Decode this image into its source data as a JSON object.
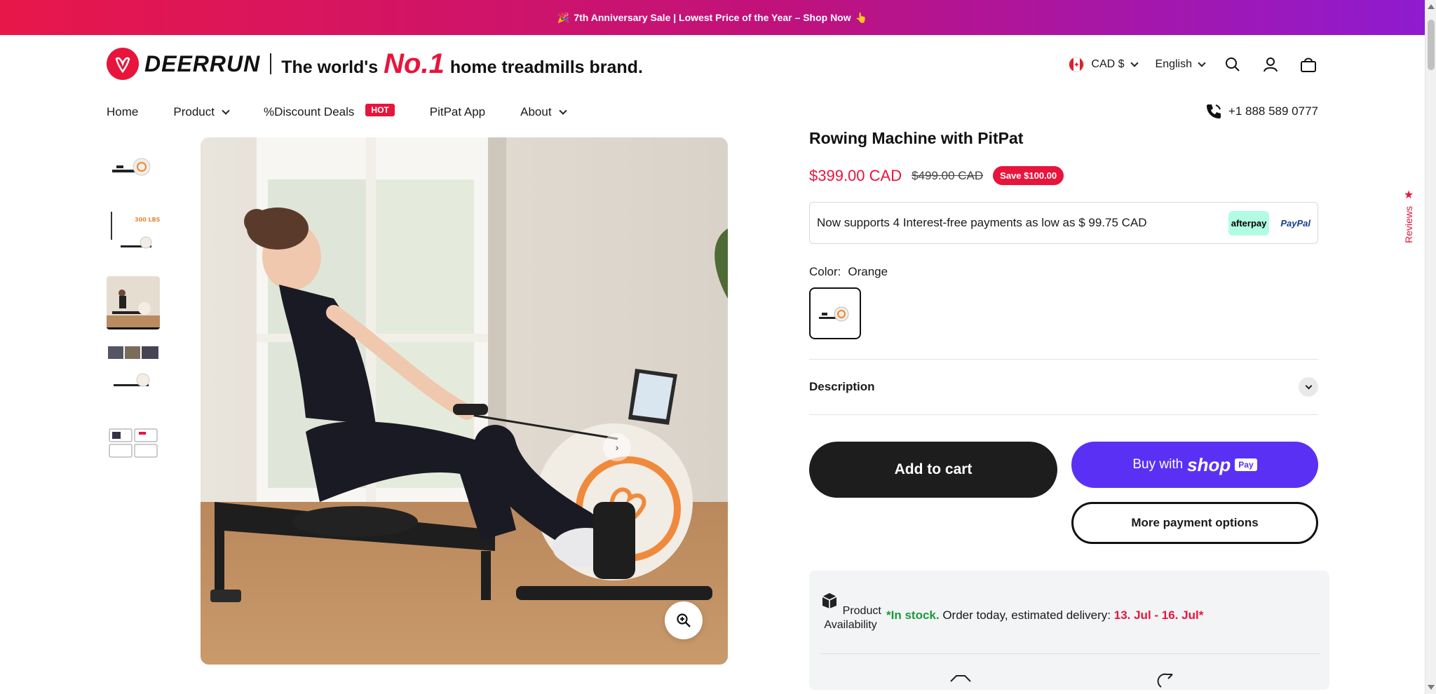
{
  "announcement": {
    "emoji_left": "🎉",
    "text": "7th Anniversary Sale | Lowest Price of the Year – Shop Now",
    "emoji_right": "👆"
  },
  "header": {
    "logo_text": "DEERRUN",
    "tagline_pre": "The world's",
    "tagline_no1": "No.1",
    "tagline_post": "home treadmills brand.",
    "currency": "CAD $",
    "language": "English",
    "icons": [
      "search-icon",
      "account-icon",
      "cart-icon"
    ]
  },
  "nav": {
    "items": [
      "Home",
      "Product",
      "%Discount Deals",
      "PitPat App",
      "About"
    ],
    "hot_badge": "HOT",
    "phone": "+1 888 589 0777"
  },
  "product": {
    "title": "Rowing Machine with PitPat",
    "price": "$399.00 CAD",
    "old_price": "$499.00 CAD",
    "save": "Save $100.00",
    "installments": "Now supports 4 Interest-free payments as low as $ 99.75 CAD",
    "afterpay": "afterpay",
    "paypal": "PayPal",
    "color_label": "Color:",
    "color_value": "Orange",
    "description_label": "Description",
    "add_to_cart": "Add to cart",
    "buy_with": "Buy with",
    "shop": "shop",
    "pay": "Pay",
    "more_payment": "More payment options",
    "availability_label": "Product Availability",
    "stock_star": "*",
    "in_stock": "In stock.",
    "order_text": "Order today, estimated delivery:",
    "delivery_dates": "13. Jul - 16. Jul",
    "stock_end": "*"
  },
  "gallery": {
    "thumb_count": 5,
    "active_index": 2,
    "thumb2_label": "300 LBS"
  },
  "reviews_tab": "Reviews",
  "colors": {
    "accent": "#e8143c",
    "shop_pay": "#5a31f4",
    "in_stock": "#1a9b3a"
  }
}
